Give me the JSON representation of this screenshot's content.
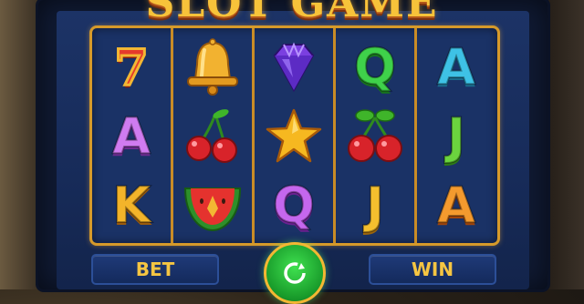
{
  "title": "SLOT GAME",
  "reels": [
    {
      "symbols": [
        "seven-symbol",
        "letter-A",
        "letter-K"
      ],
      "letters": [
        "7",
        "A",
        "K"
      ]
    },
    {
      "symbols": [
        "bell-symbol",
        "cherry-symbol",
        "watermelon-symbol"
      ]
    },
    {
      "symbols": [
        "diamond-symbol",
        "star-symbol",
        "letter-Q"
      ],
      "letters": [
        "",
        "",
        "Q"
      ]
    },
    {
      "symbols": [
        "letter-Q",
        "cherry-symbol",
        "letter-J"
      ],
      "letters": [
        "Q",
        "",
        "J"
      ]
    },
    {
      "symbols": [
        "letter-A",
        "letter-J",
        "letter-A"
      ],
      "letters": [
        "A",
        "J",
        "A"
      ]
    }
  ],
  "controls": {
    "bet_label": "BET",
    "win_label": "WIN",
    "spin_icon": "spin-icon"
  },
  "colors": {
    "gold": "#f7c33a",
    "reel_border": "#d69a2a",
    "screen_blue": "#1c3366",
    "spin_green": "#2bc23d"
  }
}
